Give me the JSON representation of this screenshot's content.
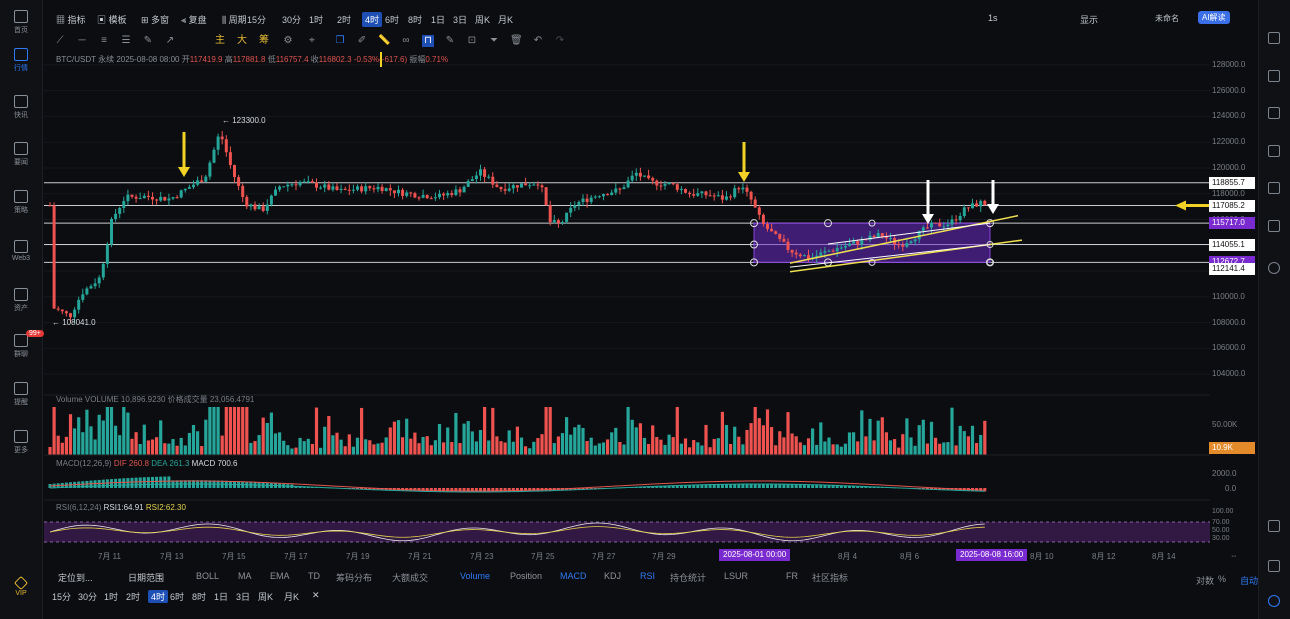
{
  "left_rail": [
    {
      "label": "首页",
      "icon": "home-icon"
    },
    {
      "label": "行情",
      "icon": "chart-bar-icon",
      "active": true
    },
    {
      "label": "快讯",
      "icon": "news-icon"
    },
    {
      "label": "要闻",
      "icon": "article-icon"
    },
    {
      "label": "策略",
      "icon": "strategy-icon"
    },
    {
      "label": "Web3",
      "icon": "web3-icon"
    },
    {
      "label": "资产",
      "icon": "wallet-icon"
    },
    {
      "label": "群聊",
      "icon": "chat-icon",
      "badge": "99+"
    },
    {
      "label": "提醒",
      "icon": "bell-icon"
    },
    {
      "label": "更多",
      "icon": "more-grid-icon"
    },
    {
      "label": "VIP",
      "icon": "vip-diamond-icon"
    }
  ],
  "topbar": {
    "items": [
      "指标",
      "模板",
      "多窗",
      "复盘",
      "周期",
      "15分",
      "30分",
      "1时",
      "2时",
      "4时",
      "6时",
      "8时",
      "1日",
      "3日",
      "周K",
      "月K"
    ],
    "active": "4时",
    "right": {
      "interval": "1s",
      "display": "显示",
      "login": "未命名",
      "ai": "AI解读"
    }
  },
  "info_line": {
    "symbol": "BTC/USDT 永续",
    "date": "2025-08-08 08:00",
    "open_label": "开",
    "open": "117419.9",
    "high_label": "高",
    "high": "117881.8",
    "low_label": "低",
    "low": "116757.4",
    "close_label": "收",
    "close": "116802.3",
    "change": "-0.53%(-617.6)",
    "amp_label": "振幅",
    "amp": "0.71%"
  },
  "y_axis": [
    "128000.0",
    "126000.0",
    "124000.0",
    "122000.0",
    "120000.0",
    "118000.0",
    "116000.0",
    "114000.0",
    "112000.0",
    "110000.0",
    "108000.0",
    "106000.0",
    "104000.0"
  ],
  "price_boxes": [
    {
      "value": "118855.7",
      "bg": "#ffffff",
      "fg": "#111111"
    },
    {
      "value": "117085.2",
      "bg": "#ffffff",
      "fg": "#111111"
    },
    {
      "value": "115717.0",
      "bg": "#7a2bd0",
      "fg": "#ffffff"
    },
    {
      "value": "114055.1",
      "bg": "#ffffff",
      "fg": "#111111"
    },
    {
      "value": "112672.7",
      "bg": "#7a2bd0",
      "fg": "#ffffff"
    },
    {
      "value": "112141.4",
      "bg": "#ffffff",
      "fg": "#111111"
    }
  ],
  "annotations": {
    "high": "123300.0",
    "low": "108041.0"
  },
  "x_axis": [
    "7月 11",
    "7月 13",
    "7月 15",
    "7月 17",
    "7月 19",
    "7月 21",
    "7月 23",
    "7月 25",
    "7月 27",
    "7月 29",
    "8月 4",
    "8月 6",
    "8月 10",
    "8月 12",
    "8月 14"
  ],
  "x_boxes": [
    "2025-08-01 00:00",
    "2025-08-08 16:00"
  ],
  "volume": {
    "label": "Volume",
    "text": "VOLUME 10,896.9230 价格成交量 23,056.4791",
    "tick": "50.00K",
    "box": "10.9K"
  },
  "macd": {
    "label": "MACD(12,26,9)",
    "dif": "DIF 260.8",
    "dea": "DEA 261.3",
    "macd": "MACD 700.6",
    "ticks": [
      "2000.0",
      "0.0"
    ]
  },
  "rsi": {
    "label": "RSI(6,12,24)",
    "rsi1": "RSI1:64.91",
    "rsi2": "RSI2:62.30",
    "ticks": [
      "100.00",
      "70.00",
      "50.00",
      "30.00"
    ]
  },
  "bottom_tabs": {
    "range": "定位到...",
    "date_range": "日期范围",
    "items": [
      "BOLL",
      "MA",
      "EMA",
      "TD",
      "筹码分布",
      "大额成交",
      "Volume",
      "Position",
      "MACD",
      "KDJ",
      "RSI",
      "持仓统计",
      "LSUR",
      "FR",
      "社区指标"
    ],
    "active": [
      "Volume",
      "MACD",
      "RSI"
    ],
    "right": [
      "对数",
      "%",
      "自动"
    ]
  },
  "bottom_periods": {
    "items": [
      "15分",
      "30分",
      "1时",
      "2时",
      "4时",
      "6时",
      "8时",
      "1日",
      "3日",
      "周K",
      "月K"
    ],
    "active": "4时"
  },
  "chart_data": {
    "type": "candlestick",
    "symbol": "BTC/USDT",
    "interval": "4h",
    "ylim": [
      103000,
      129000
    ],
    "x_range": [
      "2025-07-10",
      "2025-08-15"
    ],
    "horizontal_levels": [
      118855.7,
      117085.2,
      115717.0,
      114055.1,
      112672.7
    ],
    "marked_high": 123300.0,
    "marked_low": 108041.0,
    "last_close": 116802.3,
    "colors": {
      "up": "#26a69a",
      "down": "#ef5350",
      "box": "#6a2bc4",
      "channel": "#f0e050"
    }
  }
}
